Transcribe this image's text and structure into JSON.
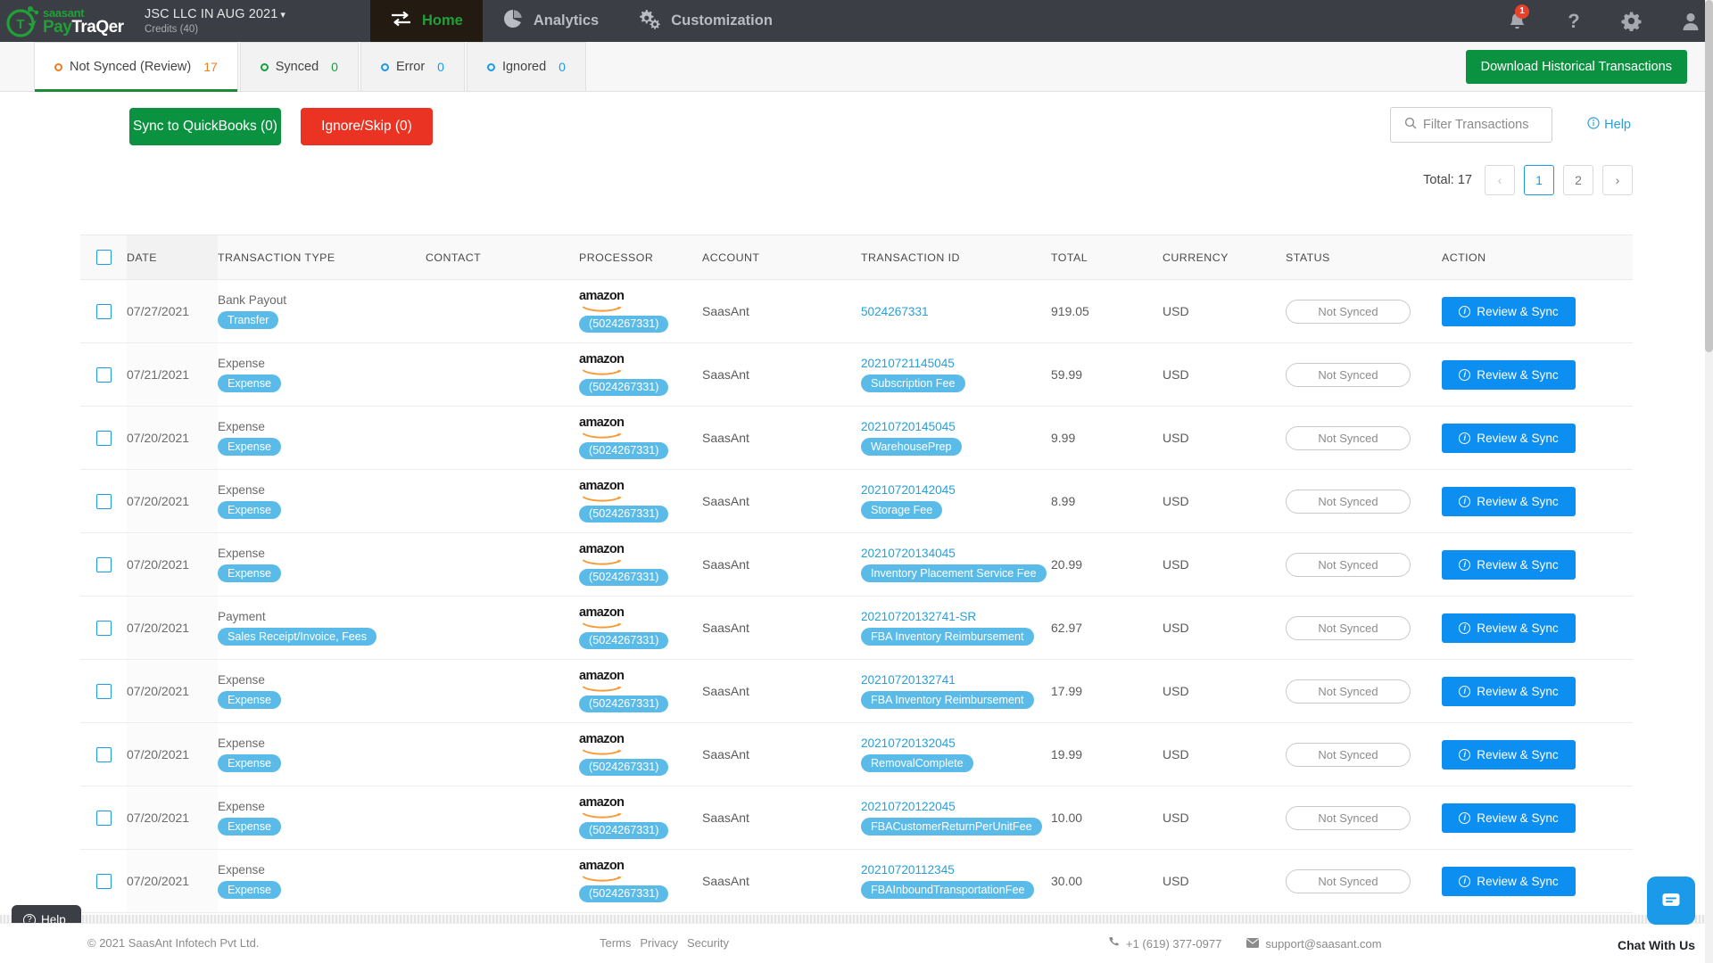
{
  "header": {
    "brand": {
      "saasant": "saasant",
      "pay": "Pay",
      "traqer": "TraQer"
    },
    "company_name": "JSC LLC IN AUG 2021",
    "credits": "Credits (40)",
    "nav": [
      {
        "label": "Home",
        "icon": "transfer-arrows-icon",
        "active": true
      },
      {
        "label": "Analytics",
        "icon": "pie-chart-icon",
        "active": false
      },
      {
        "label": "Customization",
        "icon": "gears-icon",
        "active": false
      }
    ],
    "notification_count": "1",
    "icons": [
      "bell-icon",
      "question-mark-icon",
      "gear-icon",
      "user-icon"
    ]
  },
  "tabs": [
    {
      "label": "Not Synced (Review)",
      "count": "17",
      "color": "#f07d20",
      "active": true
    },
    {
      "label": "Synced",
      "count": "0",
      "color": "#14a03c",
      "active": false
    },
    {
      "label": "Error",
      "count": "0",
      "color": "#1a9ae8",
      "active": false
    },
    {
      "label": "Ignored",
      "count": "0",
      "color": "#1a9ae8",
      "active": false
    }
  ],
  "download_button": "Download Historical Transactions",
  "actions": {
    "sync": "Sync to QuickBooks (0)",
    "ignore": "Ignore/Skip (0)",
    "filter_placeholder": "Filter Transactions",
    "help": "Help"
  },
  "pagination": {
    "total_label": "Total: 17",
    "prev": "‹",
    "pages": [
      "1",
      "2"
    ],
    "current": "1",
    "next": "›"
  },
  "table": {
    "columns": [
      "DATE",
      "TRANSACTION TYPE",
      "CONTACT",
      "PROCESSOR",
      "ACCOUNT",
      "TRANSACTION ID",
      "TOTAL",
      "CURRENCY",
      "STATUS",
      "ACTION"
    ],
    "processor_name": "amazon",
    "status_label": "Not Synced",
    "action_label": "Review & Sync",
    "rows": [
      {
        "date": "07/27/2021",
        "type": "Bank Payout",
        "type_tag": "Transfer",
        "contact": "",
        "processor_id": "(5024267331)",
        "account": "SaasAnt",
        "txid": "5024267331",
        "txid_tag": "",
        "total": "919.05",
        "currency": "USD"
      },
      {
        "date": "07/21/2021",
        "type": "Expense",
        "type_tag": "Expense",
        "contact": "",
        "processor_id": "(5024267331)",
        "account": "SaasAnt",
        "txid": "20210721145045",
        "txid_tag": "Subscription Fee",
        "total": "59.99",
        "currency": "USD"
      },
      {
        "date": "07/20/2021",
        "type": "Expense",
        "type_tag": "Expense",
        "contact": "",
        "processor_id": "(5024267331)",
        "account": "SaasAnt",
        "txid": "20210720145045",
        "txid_tag": "WarehousePrep",
        "total": "9.99",
        "currency": "USD"
      },
      {
        "date": "07/20/2021",
        "type": "Expense",
        "type_tag": "Expense",
        "contact": "",
        "processor_id": "(5024267331)",
        "account": "SaasAnt",
        "txid": "20210720142045",
        "txid_tag": "Storage Fee",
        "total": "8.99",
        "currency": "USD"
      },
      {
        "date": "07/20/2021",
        "type": "Expense",
        "type_tag": "Expense",
        "contact": "",
        "processor_id": "(5024267331)",
        "account": "SaasAnt",
        "txid": "20210720134045",
        "txid_tag": "Inventory Placement Service Fee",
        "total": "20.99",
        "currency": "USD"
      },
      {
        "date": "07/20/2021",
        "type": "Payment",
        "type_tag": "Sales Receipt/Invoice, Fees",
        "contact": "",
        "processor_id": "(5024267331)",
        "account": "SaasAnt",
        "txid": "20210720132741-SR",
        "txid_tag": "FBA Inventory Reimbursement",
        "total": "62.97",
        "currency": "USD"
      },
      {
        "date": "07/20/2021",
        "type": "Expense",
        "type_tag": "Expense",
        "contact": "",
        "processor_id": "(5024267331)",
        "account": "SaasAnt",
        "txid": "20210720132741",
        "txid_tag": "FBA Inventory Reimbursement",
        "total": "17.99",
        "currency": "USD"
      },
      {
        "date": "07/20/2021",
        "type": "Expense",
        "type_tag": "Expense",
        "contact": "",
        "processor_id": "(5024267331)",
        "account": "SaasAnt",
        "txid": "20210720132045",
        "txid_tag": "RemovalComplete",
        "total": "19.99",
        "currency": "USD"
      },
      {
        "date": "07/20/2021",
        "type": "Expense",
        "type_tag": "Expense",
        "contact": "",
        "processor_id": "(5024267331)",
        "account": "SaasAnt",
        "txid": "20210720122045",
        "txid_tag": "FBACustomerReturnPerUnitFee",
        "total": "10.00",
        "currency": "USD"
      },
      {
        "date": "07/20/2021",
        "type": "Expense",
        "type_tag": "Expense",
        "contact": "",
        "processor_id": "(5024267331)",
        "account": "SaasAnt",
        "txid": "20210720112345",
        "txid_tag": "FBAInboundTransportationFee",
        "total": "30.00",
        "currency": "USD"
      }
    ]
  },
  "footer": {
    "copyright": "© 2021 SaasAnt Infotech Pvt Ltd.",
    "links": [
      "Terms",
      "Privacy",
      "Security"
    ],
    "phone": "+1 (619) 377-0977",
    "email": "support@saasant.com",
    "help_tab": "Help",
    "chat_label": "Chat With Us"
  }
}
